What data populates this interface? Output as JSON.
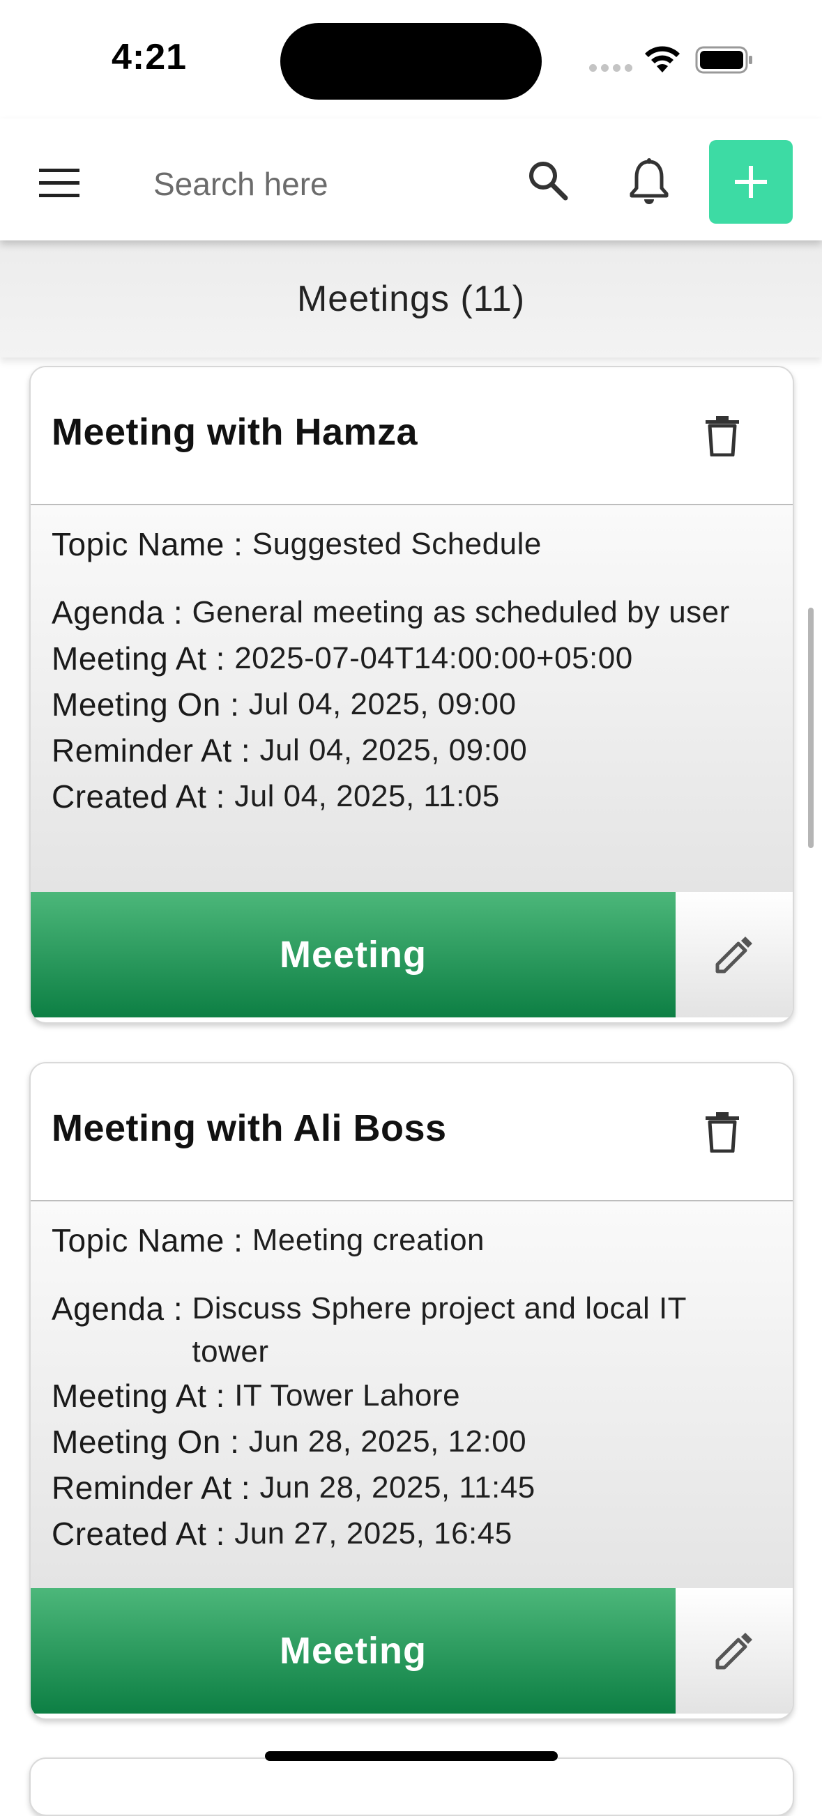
{
  "status_bar": {
    "time": "4:21"
  },
  "top_bar": {
    "search_placeholder": "Search here",
    "icons": {
      "menu": "menu-icon",
      "search": "search-icon",
      "notifications": "bell-icon",
      "add": "plus-icon"
    },
    "accent_color": "#3ddba4"
  },
  "page": {
    "title": "Meetings (11)"
  },
  "labels": {
    "topic": "Topic Name :",
    "agenda": "Agenda :",
    "meeting_at": "Meeting At :",
    "meeting_on": "Meeting On :",
    "reminder_at": "Reminder At :",
    "created_at": "Created At :"
  },
  "meetings": [
    {
      "title": "Meeting with Hamza",
      "topic": "Suggested Schedule",
      "agenda": "General meeting as scheduled by user",
      "meeting_at": "2025-07-04T14:00:00+05:00",
      "meeting_on": "Jul 04, 2025, 09:00",
      "reminder_at": "Jul 04, 2025, 09:00",
      "created_at": "Jul 04, 2025, 11:05",
      "button_label": "Meeting"
    },
    {
      "title": "Meeting with Ali Boss",
      "topic": "Meeting creation",
      "agenda": "Discuss Sphere project and local IT tower",
      "meeting_at": "IT Tower Lahore",
      "meeting_on": "Jun 28, 2025, 12:00",
      "reminder_at": "Jun 28, 2025, 11:45",
      "created_at": "Jun 27, 2025, 16:45",
      "button_label": "Meeting"
    }
  ],
  "colors": {
    "meeting_button_top": "#4cb77a",
    "meeting_button_bottom": "#0d7f44"
  }
}
